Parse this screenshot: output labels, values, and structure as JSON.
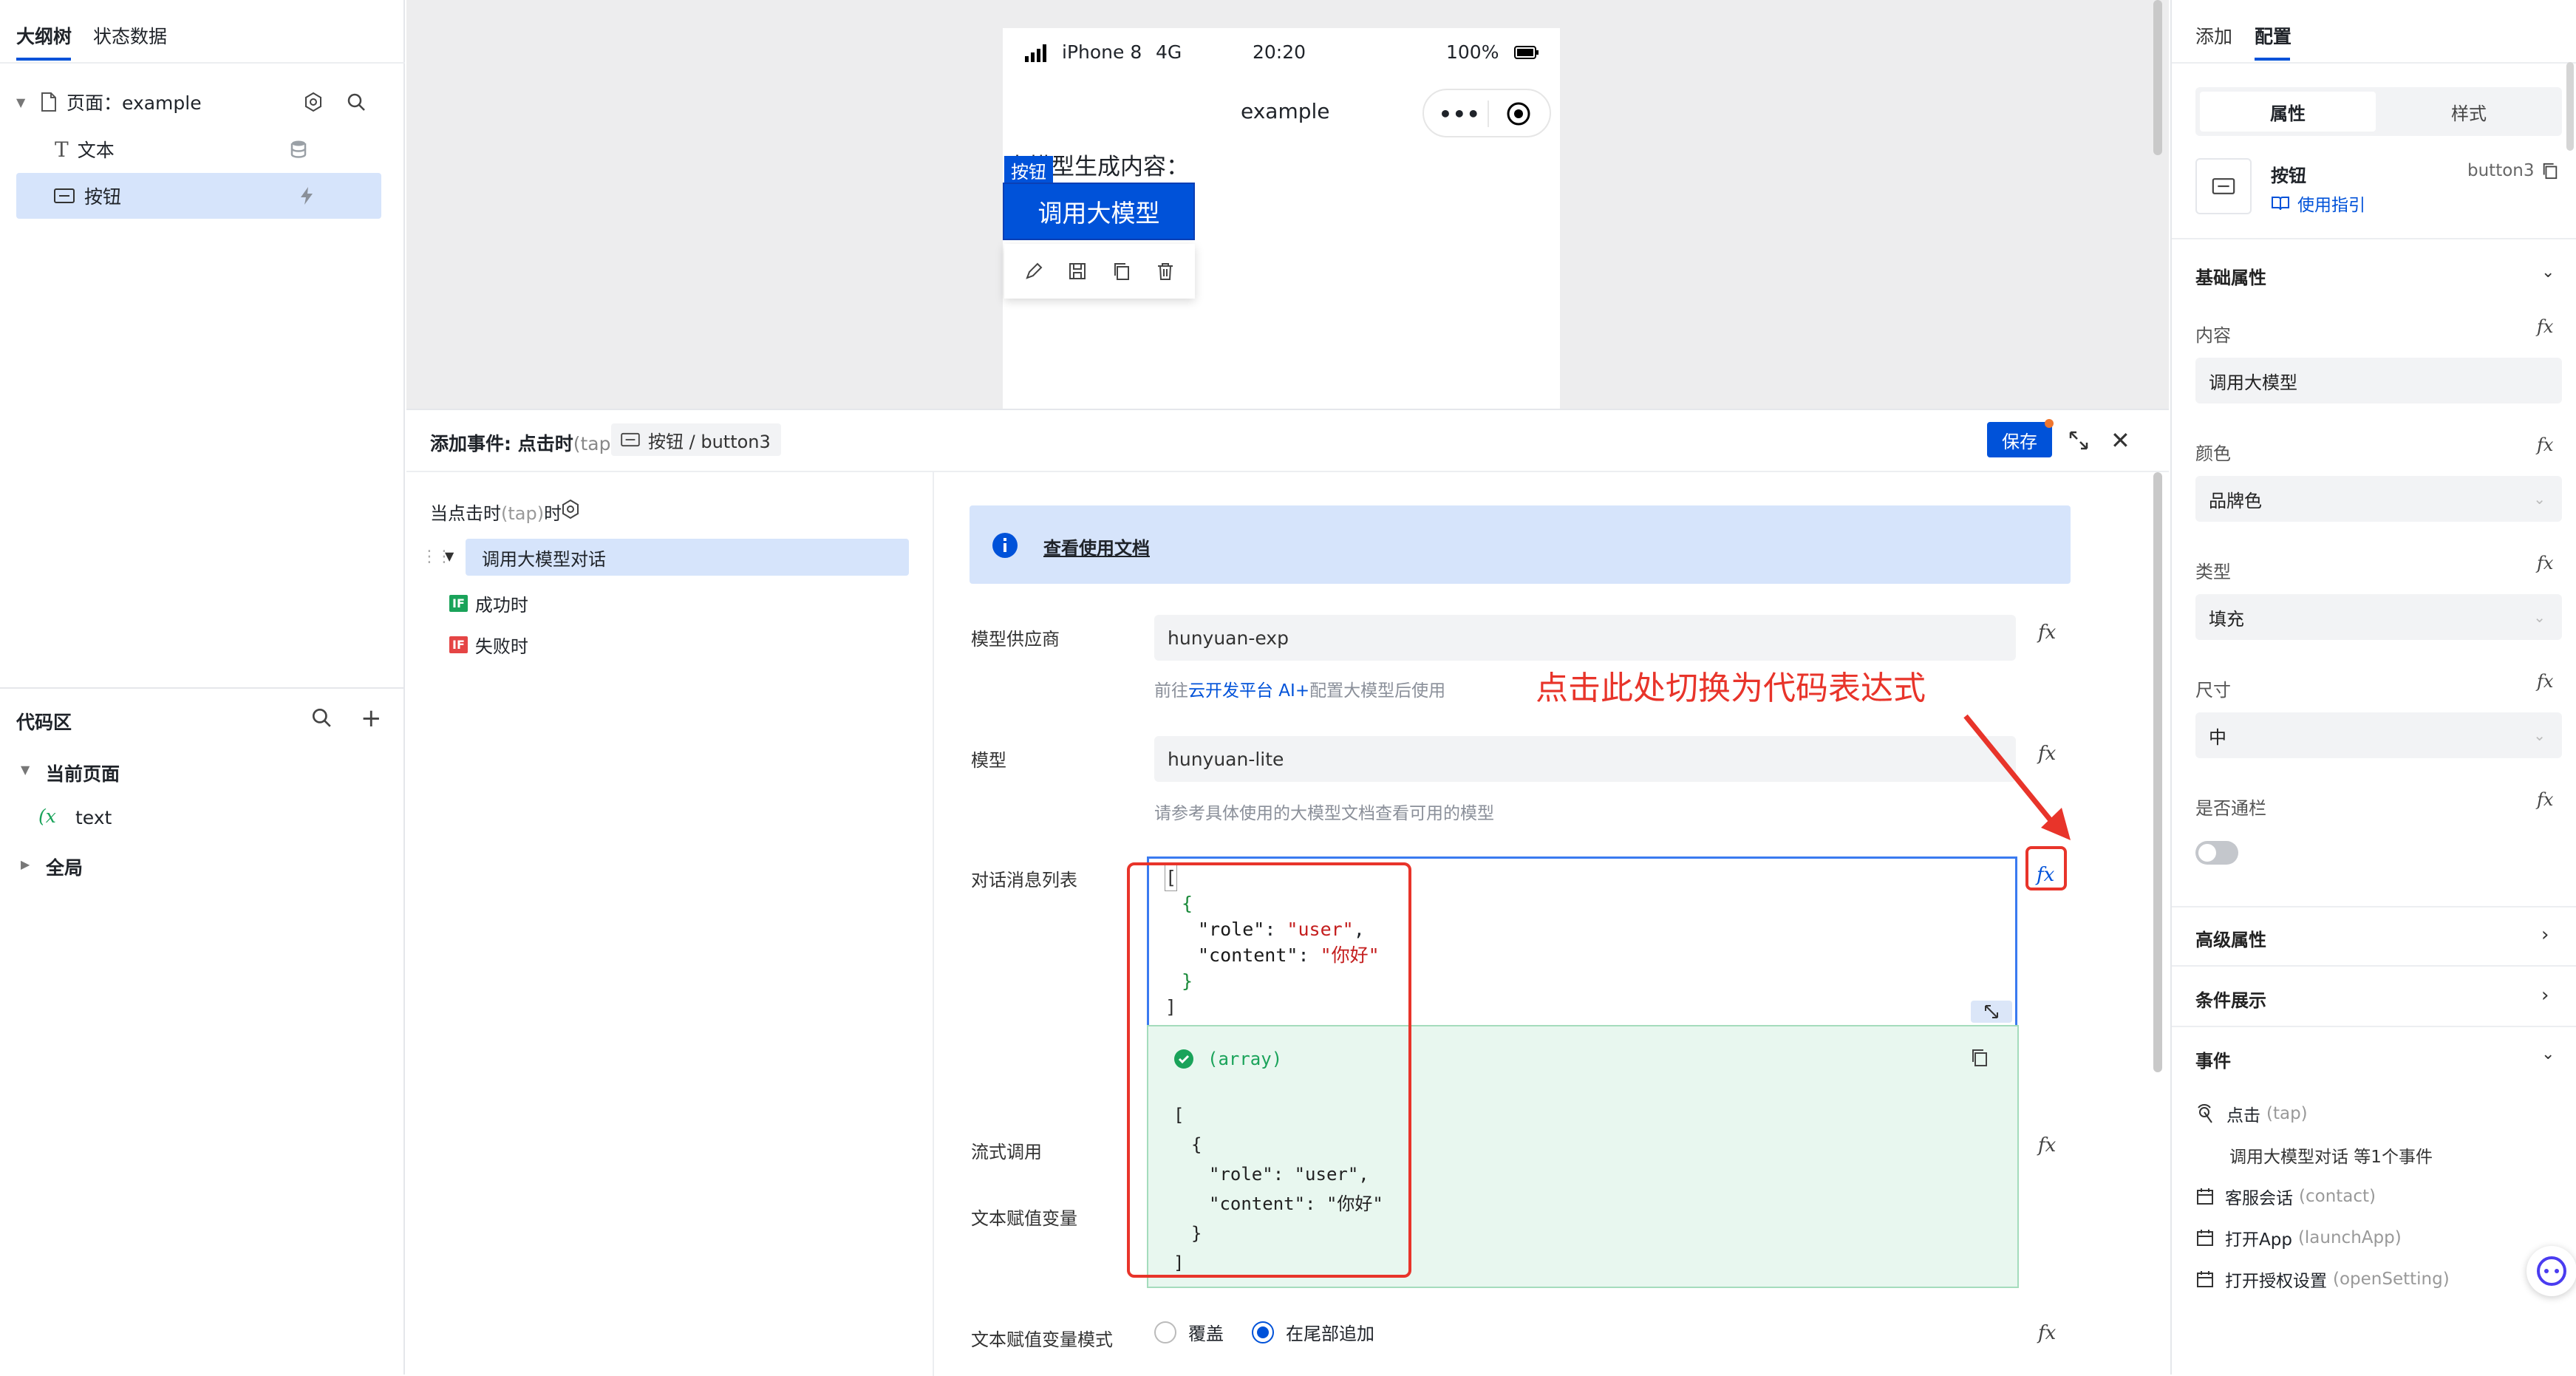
{
  "left": {
    "tabs": [
      "大纲树",
      "状态数据"
    ],
    "tree": [
      {
        "label": "页面：example"
      },
      {
        "label": "文本"
      },
      {
        "label": "按钮"
      }
    ],
    "code_area": {
      "title": "代码区",
      "items": [
        {
          "label": "当前页面"
        },
        {
          "label": "text"
        },
        {
          "label": "全局"
        }
      ]
    }
  },
  "phone": {
    "carrier": "iPhone 8",
    "network": "4G",
    "time": "20:20",
    "battery": "100%",
    "title": "example",
    "content_text": "大模型生成内容：",
    "selection_badge": "按钮",
    "button_label": "调用大模型"
  },
  "event": {
    "title": "添加事件: 点击时",
    "title_suffix": "(tap)",
    "breadcrumb": "按钮 / button3",
    "save_label": "保存",
    "when_label": "当点击时",
    "when_suffix": "(tap)",
    "when_tail": "时",
    "actions": [
      {
        "label": "调用大模型对话"
      },
      {
        "badge": "IF",
        "label": "成功时",
        "color": "#1aa35a"
      },
      {
        "badge": "IF",
        "label": "失败时",
        "color": "#e54545"
      }
    ],
    "doc_link": "查看使用文档",
    "fields": {
      "provider_label": "模型供应商",
      "provider_value": "hunyuan-exp",
      "provider_hint_prefix": "前往",
      "provider_hint_link": "云开发平台 AI+",
      "provider_hint_suffix": "配置大模型后使用",
      "model_label": "模型",
      "model_value": "hunyuan-lite",
      "model_hint": "请参考具体使用的大模型文档查看可用的模型",
      "messages_label": "对话消息列表",
      "stream_label": "流式调用",
      "assign_label": "文本赋值变量",
      "mode_label": "文本赋值变量模式",
      "mode_options": [
        "覆盖",
        "在尾部追加"
      ]
    },
    "code_lines": [
      {
        "indent": 0,
        "text": "["
      },
      {
        "indent": 1,
        "text": "{"
      },
      {
        "indent": 2,
        "key": "\"role\"",
        "value": "\"user\"",
        "comma": ","
      },
      {
        "indent": 2,
        "key": "\"content\"",
        "value": "\"你好\"",
        "comma": ""
      },
      {
        "indent": 1,
        "text": "}"
      },
      {
        "indent": 0,
        "text": "]"
      }
    ],
    "result_type": "(array)",
    "result_lines": [
      {
        "indent": 0,
        "text": "["
      },
      {
        "indent": 1,
        "text": "{"
      },
      {
        "indent": 2,
        "text": "\"role\": \"user\","
      },
      {
        "indent": 2,
        "text": "\"content\": \"你好\""
      },
      {
        "indent": 1,
        "text": "}"
      },
      {
        "indent": 0,
        "text": "]"
      }
    ],
    "annotation": "点击此处切换为代码表达式"
  },
  "right": {
    "tabs": [
      "添加",
      "配置"
    ],
    "subtabs": [
      "属性",
      "样式"
    ],
    "component": {
      "name": "按钮",
      "id": "button3",
      "guide": "使用指引"
    },
    "basic_title": "基础属性",
    "props": [
      {
        "label": "内容",
        "value": "调用大模型"
      },
      {
        "label": "颜色",
        "value": "品牌色"
      },
      {
        "label": "类型",
        "value": "填充"
      },
      {
        "label": "尺寸",
        "value": "中"
      }
    ],
    "switch_label": "是否通栏",
    "advanced_title": "高级属性",
    "condition_title": "条件展示",
    "events_title": "事件",
    "events": [
      {
        "label": "点击",
        "suffix": "(tap)"
      },
      {
        "label": "客服会话",
        "suffix": "(contact)"
      },
      {
        "label": "打开App",
        "suffix": "(launchApp)"
      },
      {
        "label": "打开授权设置",
        "suffix": "(openSetting)"
      }
    ],
    "event_summary": "调用大模型对话 等1个事件"
  },
  "colors": {
    "primary": "#0052d9",
    "annotation": "#e8342a",
    "success_bg": "#e8f7ef",
    "info_bg": "#d6e4fb"
  }
}
